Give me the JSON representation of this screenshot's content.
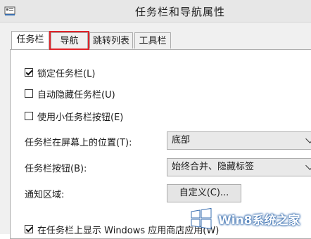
{
  "window": {
    "title": "任务栏和导航属性"
  },
  "tabs": [
    {
      "label": "任务栏"
    },
    {
      "label": "导航"
    },
    {
      "label": "跳转列表"
    },
    {
      "label": "工具栏"
    }
  ],
  "taskbar": {
    "lock": {
      "label": "锁定任务栏(L)",
      "checked": true
    },
    "autohide": {
      "label": "自动隐藏任务栏(U)",
      "checked": false
    },
    "small_buttons": {
      "label": "使用小任务栏按钮(E)",
      "checked": false
    },
    "location": {
      "label": "任务栏在屏幕上的位置(T):",
      "value": "底部"
    },
    "buttons": {
      "label": "任务栏按钮(B):",
      "value": "始终合并、隐藏标签"
    },
    "notification": {
      "label": "通知区域:",
      "button": "自定义(C)..."
    },
    "show_store_apps": {
      "label": "在任务栏上显示 Windows 应用商店应用(W)",
      "checked": true
    }
  },
  "watermark": {
    "text": "Win8系统之家"
  },
  "colors": {
    "highlight": "#e0242a",
    "accent": "#3a6fb0"
  }
}
